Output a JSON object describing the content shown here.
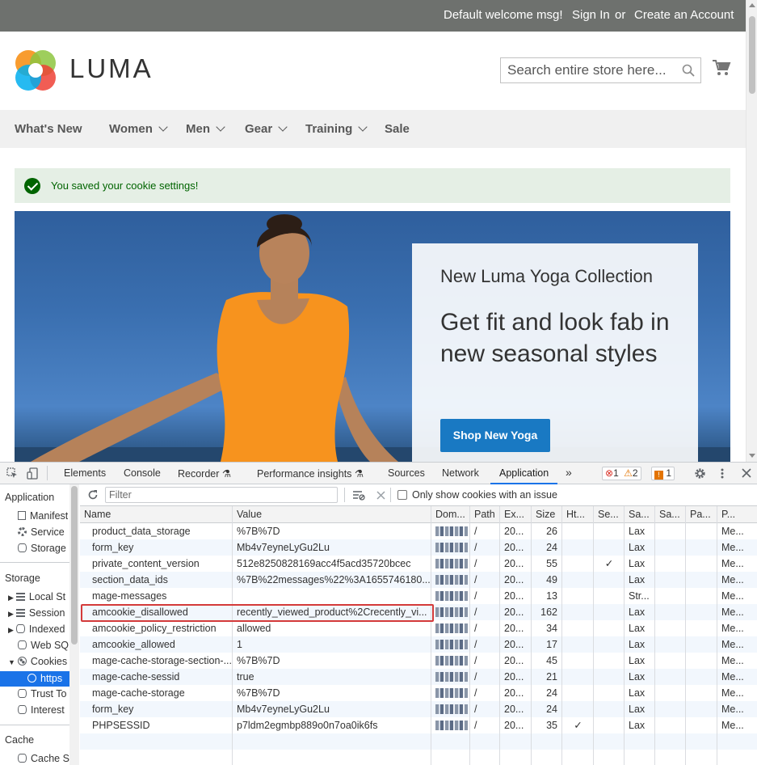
{
  "top_panel": {
    "welcome": "Default welcome msg!",
    "sign_in": "Sign In",
    "or": "or",
    "create_account": "Create an Account"
  },
  "header": {
    "logo_text": "LUMA",
    "search_placeholder": "Search entire store here...",
    "cart_icon": "cart-icon"
  },
  "nav": {
    "items": [
      {
        "label": "What's New",
        "has_submenu": false
      },
      {
        "label": "Women",
        "has_submenu": true
      },
      {
        "label": "Men",
        "has_submenu": true
      },
      {
        "label": "Gear",
        "has_submenu": true
      },
      {
        "label": "Training",
        "has_submenu": true
      },
      {
        "label": "Sale",
        "has_submenu": false
      }
    ]
  },
  "message": {
    "text": "You saved your cookie settings!",
    "type": "success"
  },
  "hero": {
    "subtitle": "New Luma Yoga Collection",
    "headline": "Get fit and look fab in new seasonal styles",
    "button": "Shop New Yoga"
  },
  "devtools": {
    "tabs": [
      "Elements",
      "Console",
      "Recorder",
      "Performance insights",
      "Sources",
      "Network",
      "Application"
    ],
    "active_tab": "Application",
    "more": "»",
    "errors": "1",
    "warnings": "2",
    "issues": "1",
    "sidebar": {
      "application_header": "Application",
      "application_items": [
        "Manifest",
        "Service",
        "Storage"
      ],
      "storage_header": "Storage",
      "storage_items": [
        "Local St",
        "Session",
        "Indexed",
        "Web SQ",
        "Cookies",
        "https",
        "Trust To",
        "Interest"
      ],
      "cache_header": "Cache",
      "cache_items": [
        "Cache S"
      ]
    },
    "filter_placeholder": "Filter",
    "only_issues_label": "Only show cookies with an issue",
    "columns": [
      "Name",
      "Value",
      "Dom...",
      "Path",
      "Ex...",
      "Size",
      "Ht...",
      "Se...",
      "Sa...",
      "Sa...",
      "Pa...",
      "P..."
    ],
    "rows": [
      {
        "name": "product_data_storage",
        "value": "%7B%7D",
        "path": "/",
        "expires": "20...",
        "size": "26",
        "http": "",
        "secure": "",
        "samesite": "Lax",
        "priority": "Me..."
      },
      {
        "name": "form_key",
        "value": "Mb4v7eyneLyGu2Lu",
        "path": "/",
        "expires": "20...",
        "size": "24",
        "http": "",
        "secure": "",
        "samesite": "Lax",
        "priority": "Me..."
      },
      {
        "name": "private_content_version",
        "value": "512e8250828169acc4f5acd35720bcec",
        "path": "/",
        "expires": "20...",
        "size": "55",
        "http": "",
        "secure": "✓",
        "samesite": "Lax",
        "priority": "Me..."
      },
      {
        "name": "section_data_ids",
        "value": "%7B%22messages%22%3A1655746180...",
        "path": "/",
        "expires": "20...",
        "size": "49",
        "http": "",
        "secure": "",
        "samesite": "Lax",
        "priority": "Me..."
      },
      {
        "name": "mage-messages",
        "value": "",
        "path": "/",
        "expires": "20...",
        "size": "13",
        "http": "",
        "secure": "",
        "samesite": "Str...",
        "priority": "Me..."
      },
      {
        "name": "amcookie_disallowed",
        "value": "recently_viewed_product%2Crecently_vi...",
        "path": "/",
        "expires": "20...",
        "size": "162",
        "http": "",
        "secure": "",
        "samesite": "Lax",
        "priority": "Me..."
      },
      {
        "name": "amcookie_policy_restriction",
        "value": "allowed",
        "path": "/",
        "expires": "20...",
        "size": "34",
        "http": "",
        "secure": "",
        "samesite": "Lax",
        "priority": "Me..."
      },
      {
        "name": "amcookie_allowed",
        "value": "1",
        "path": "/",
        "expires": "20...",
        "size": "17",
        "http": "",
        "secure": "",
        "samesite": "Lax",
        "priority": "Me..."
      },
      {
        "name": "mage-cache-storage-section-...",
        "value": "%7B%7D",
        "path": "/",
        "expires": "20...",
        "size": "45",
        "http": "",
        "secure": "",
        "samesite": "Lax",
        "priority": "Me..."
      },
      {
        "name": "mage-cache-sessid",
        "value": "true",
        "path": "/",
        "expires": "20...",
        "size": "21",
        "http": "",
        "secure": "",
        "samesite": "Lax",
        "priority": "Me..."
      },
      {
        "name": "mage-cache-storage",
        "value": "%7B%7D",
        "path": "/",
        "expires": "20...",
        "size": "24",
        "http": "",
        "secure": "",
        "samesite": "Lax",
        "priority": "Me..."
      },
      {
        "name": "form_key",
        "value": "Mb4v7eyneLyGu2Lu",
        "path": "/",
        "expires": "20...",
        "size": "24",
        "http": "",
        "secure": "",
        "samesite": "Lax",
        "priority": "Me..."
      },
      {
        "name": "PHPSESSID",
        "value": "p7ldm2egmbp889o0n7oa0ik6fs",
        "path": "/",
        "expires": "20...",
        "size": "35",
        "http": "✓",
        "secure": "",
        "samesite": "Lax",
        "priority": "Me..."
      }
    ],
    "highlighted_row": "amcookie_disallowed"
  }
}
